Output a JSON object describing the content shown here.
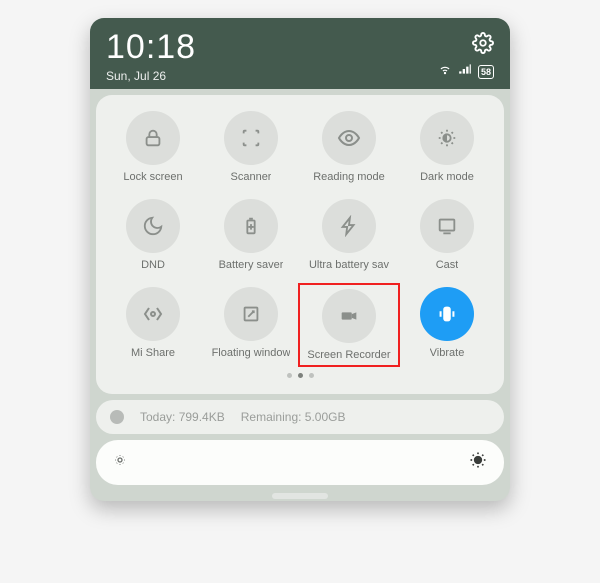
{
  "status": {
    "time": "10:18",
    "date": "Sun, Jul 26",
    "battery": "58"
  },
  "tiles": {
    "lock": {
      "label": "Lock screen"
    },
    "scanner": {
      "label": "Scanner"
    },
    "reading": {
      "label": "Reading mode"
    },
    "dark": {
      "label": "Dark mode"
    },
    "dnd": {
      "label": "DND"
    },
    "batt_saver": {
      "label": "Battery saver"
    },
    "ultra_batt": {
      "label": "Ultra battery sav"
    },
    "cast": {
      "label": "Cast"
    },
    "mishare": {
      "label": "Mi Share"
    },
    "floating": {
      "label": "Floating window"
    },
    "screenrec": {
      "label": "Screen Recorder"
    },
    "vibrate": {
      "label": "Vibrate",
      "active": true
    }
  },
  "data_usage": {
    "today_label": "Today:",
    "today_value": "799.4KB",
    "remain_label": "Remaining:",
    "remain_value": "5.00GB"
  },
  "pagination": {
    "count": 3,
    "active": 1
  }
}
